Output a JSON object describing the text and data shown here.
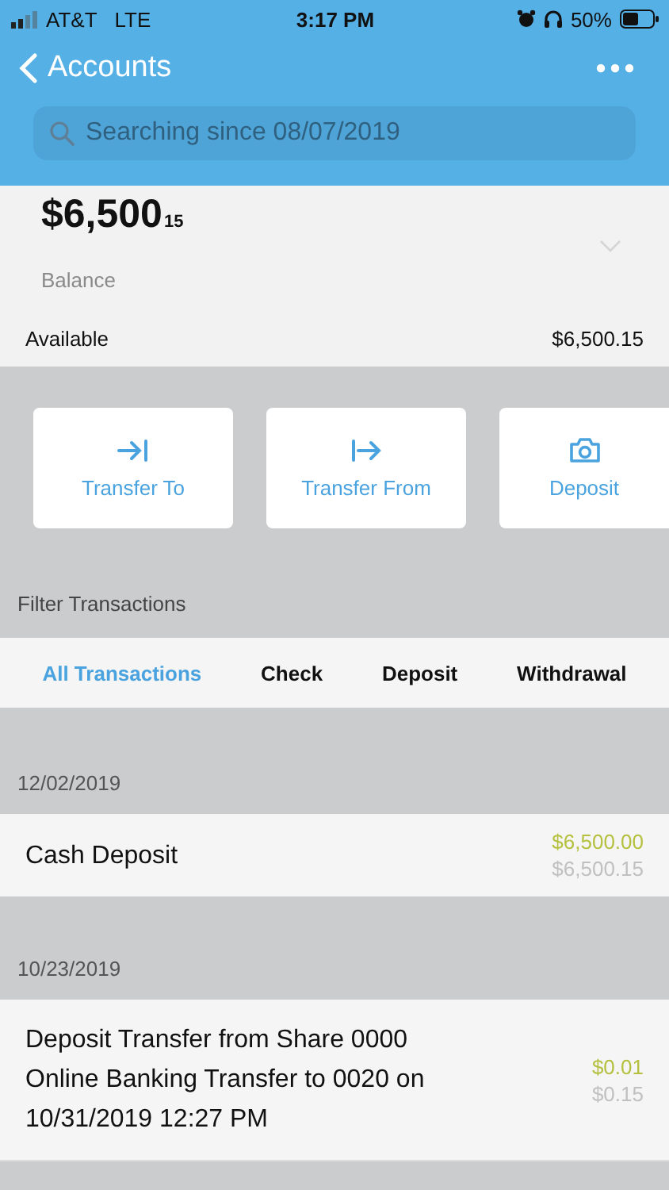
{
  "status_bar": {
    "carrier": "AT&T",
    "network": "LTE",
    "time": "3:17 PM",
    "battery": "50%"
  },
  "nav": {
    "back_label": "Accounts"
  },
  "search": {
    "placeholder": "Searching since 08/07/2019"
  },
  "balance": {
    "whole": "$6,500",
    "cents": "15",
    "label": "Balance",
    "available_label": "Available",
    "available_value": "$6,500.15"
  },
  "actions": [
    {
      "kind": "transfer-to",
      "label": "Transfer To"
    },
    {
      "kind": "transfer-from",
      "label": "Transfer From"
    },
    {
      "kind": "deposit",
      "label": "Deposit"
    }
  ],
  "filter_title": "Filter Transactions",
  "filter_tabs": [
    {
      "label": "All Transactions",
      "selected": true
    },
    {
      "label": "Check",
      "selected": false
    },
    {
      "label": "Deposit",
      "selected": false
    },
    {
      "label": "Withdrawal",
      "selected": false
    }
  ],
  "groups": [
    {
      "date": "12/02/2019",
      "transactions": [
        {
          "description": "Cash Deposit",
          "amount": "$6,500.00",
          "balance": "$6,500.15"
        }
      ]
    },
    {
      "date": "10/23/2019",
      "transactions": [
        {
          "description": "Deposit Transfer from Share 0000 Online Banking Transfer to 0020 on 10/31/2019 12:27 PM",
          "amount": "$0.01",
          "balance": "$0.15"
        }
      ]
    }
  ]
}
